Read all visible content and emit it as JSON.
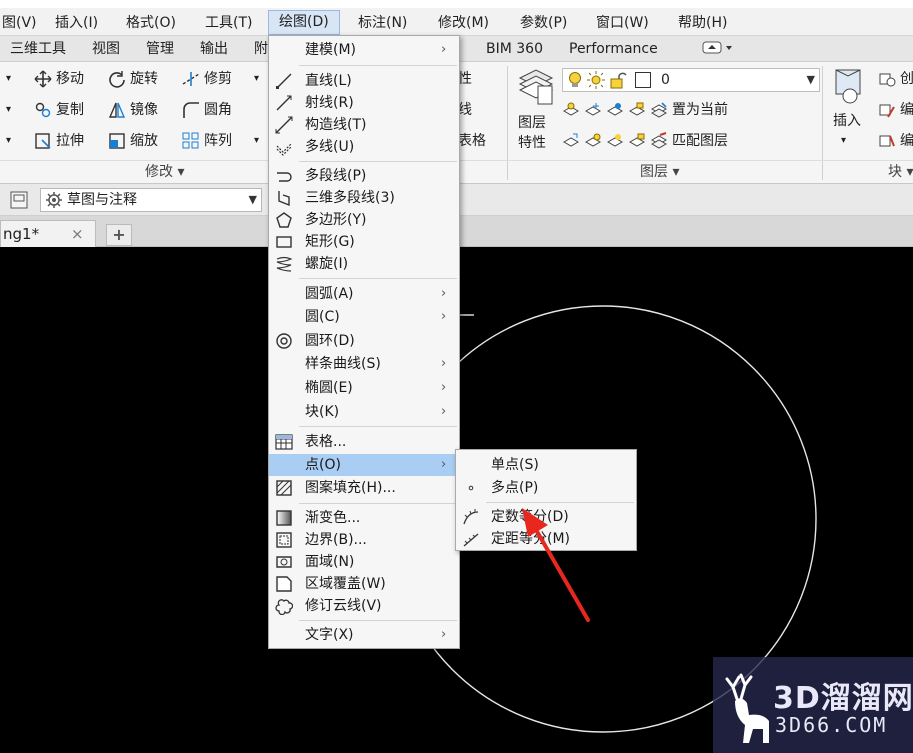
{
  "menubar": {
    "items": [
      "图(V)",
      "插入(I)",
      "格式(O)",
      "工具(T)",
      "绘图(D)",
      "标注(N)",
      "修改(M)",
      "参数(P)",
      "窗口(W)",
      "帮助(H)"
    ]
  },
  "ribbon_tabs": [
    "三维工具",
    "视图",
    "管理",
    "输出",
    "附",
    "BIM 360",
    "Performance"
  ],
  "ribbon": {
    "modify": {
      "move": "移动",
      "rotate": "旋转",
      "trim": "修剪",
      "copy": "复制",
      "mirror": "镜像",
      "fillet": "圆角",
      "stretch": "拉伸",
      "scale": "缩放",
      "array": "阵列",
      "panel_label": "修改"
    },
    "props_partial": [
      "性",
      "线",
      "表格"
    ],
    "layers": {
      "layer_props_line1": "图层",
      "layer_props_line2": "特性",
      "current_layer": "0",
      "set_current": "置为当前",
      "match_layer": "匹配图层",
      "panel_label": "图层"
    },
    "block": {
      "insert": "插入",
      "panel_label": "块",
      "partial_items": [
        "创",
        "编",
        "编"
      ]
    }
  },
  "workspace": {
    "selected": "草图与注释"
  },
  "file_tab": {
    "label": "ng1*",
    "close": "×",
    "new": "+"
  },
  "draw_menu": {
    "items": [
      {
        "label": "建模(M)",
        "submenu": true
      },
      {
        "label": "直线(L)"
      },
      {
        "label": "射线(R)"
      },
      {
        "label": "构造线(T)"
      },
      {
        "label": "多线(U)"
      },
      {
        "label": "多段线(P)"
      },
      {
        "label": "三维多段线(3)"
      },
      {
        "label": "多边形(Y)"
      },
      {
        "label": "矩形(G)"
      },
      {
        "label": "螺旋(I)"
      },
      {
        "label": "圆弧(A)",
        "submenu": true
      },
      {
        "label": "圆(C)",
        "submenu": true
      },
      {
        "label": "圆环(D)"
      },
      {
        "label": "样条曲线(S)",
        "submenu": true
      },
      {
        "label": "椭圆(E)",
        "submenu": true
      },
      {
        "label": "块(K)",
        "submenu": true
      },
      {
        "label": "表格..."
      },
      {
        "label": "点(O)",
        "submenu": true,
        "highlighted": true
      },
      {
        "label": "图案填充(H)..."
      },
      {
        "label": "渐变色..."
      },
      {
        "label": "边界(B)..."
      },
      {
        "label": "面域(N)"
      },
      {
        "label": "区域覆盖(W)"
      },
      {
        "label": "修订云线(V)"
      },
      {
        "label": "文字(X)",
        "submenu": true
      }
    ]
  },
  "point_submenu": {
    "items": [
      "单点(S)",
      "多点(P)",
      "定数等分(D)",
      "定距等分(M)"
    ]
  },
  "watermark": {
    "brand": "3D溜溜网",
    "domain": "3D66.COM"
  },
  "colors": {
    "highlight": "#a9cdf3",
    "arrow": "#e8281e",
    "canvas": "#000000"
  }
}
